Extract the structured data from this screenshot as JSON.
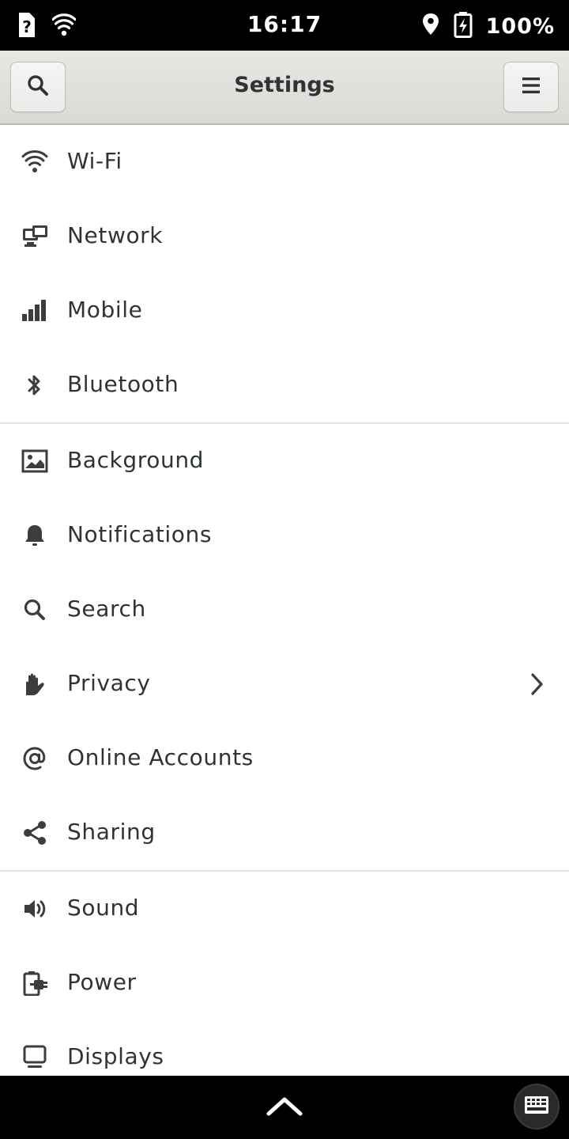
{
  "status_bar": {
    "time": "16:17",
    "battery_percent": "100%",
    "icons": [
      "unknown-sim-icon",
      "wifi-icon",
      "location-icon",
      "battery-charging-icon"
    ]
  },
  "header": {
    "title": "Settings",
    "search_icon": "search-icon",
    "menu_icon": "hamburger-menu-icon"
  },
  "settings": {
    "items": [
      {
        "label": "Wi-Fi",
        "icon": "wifi-icon"
      },
      {
        "label": "Network",
        "icon": "network-icon"
      },
      {
        "label": "Mobile",
        "icon": "signal-bars-icon"
      },
      {
        "label": "Bluetooth",
        "icon": "bluetooth-icon"
      },
      {
        "label": "Background",
        "icon": "image-icon"
      },
      {
        "label": "Notifications",
        "icon": "bell-icon"
      },
      {
        "label": "Search",
        "icon": "search-icon"
      },
      {
        "label": "Privacy",
        "icon": "hand-icon"
      },
      {
        "label": "Online Accounts",
        "icon": "at-sign-icon"
      },
      {
        "label": "Sharing",
        "icon": "share-icon"
      },
      {
        "label": "Sound",
        "icon": "speaker-icon"
      },
      {
        "label": "Power",
        "icon": "power-plug-icon"
      },
      {
        "label": "Displays",
        "icon": "display-icon"
      }
    ]
  },
  "bottom_bar": {
    "icons": [
      "chevron-up-icon",
      "keyboard-icon"
    ]
  },
  "colors": {
    "header_bg": "#e0ded9",
    "text": "#2e3436",
    "icon": "#3d3d3d",
    "separator": "#e4e2df"
  }
}
